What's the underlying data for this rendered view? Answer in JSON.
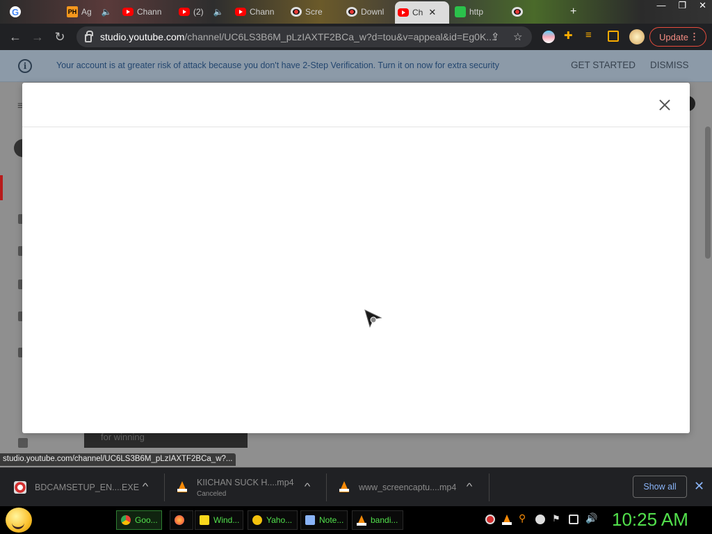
{
  "browser": {
    "tabs": [
      {
        "title": "G",
        "icon": "google-icon"
      },
      {
        "title": "Ag",
        "icon": "ph-icon",
        "muted": true
      },
      {
        "title": "Chann",
        "icon": "youtube-icon"
      },
      {
        "title": "(2)",
        "icon": "youtube-icon",
        "muted": true
      },
      {
        "title": "Chann",
        "icon": "youtube-icon"
      },
      {
        "title": "Scre",
        "icon": "recording-icon"
      },
      {
        "title": "Downl",
        "icon": "recording-icon"
      },
      {
        "title": "Ch",
        "icon": "youtube-icon",
        "active": true
      },
      {
        "title": "http",
        "icon": "green-icon"
      },
      {
        "title": "",
        "icon": "recording-icon"
      }
    ],
    "url_host": "studio.youtube.com",
    "url_rest": "/channel/UC6LS3B6M_pLzIAXTF2BCa_w?d=tou&v=appeal&id=Eg0K...",
    "update_label": "Update",
    "status_url": "studio.youtube.com/channel/UC6LS3B6M_pLzIAXTF2BCa_w?..."
  },
  "banner": {
    "text": "Your account is at greater risk of attack because you don't have 2-Step Verification. Turn it on now for extra security",
    "get_started": "GET STARTED",
    "dismiss": "DISMISS"
  },
  "background": {
    "card_text": "for winning"
  },
  "downloads": {
    "items": [
      {
        "name": "BDCAMSETUP_EN....EXE",
        "status": ""
      },
      {
        "name": "KIICHAN SUCK H....mp4",
        "status": "Canceled"
      },
      {
        "name": "www_screencaptu....mp4",
        "status": ""
      }
    ],
    "show_all": "Show all"
  },
  "taskbar": {
    "tasks": [
      {
        "label": "Goo...",
        "color": "#4285f4",
        "active": true
      },
      {
        "label": "",
        "color": "#ff7139"
      },
      {
        "label": "Wind...",
        "color": "#f9d71c"
      },
      {
        "label": "Yaho...",
        "color": "#f4c20d"
      },
      {
        "label": "Note...",
        "color": "#8ab4f8"
      },
      {
        "label": "bandi...",
        "color": "#f58a07"
      }
    ],
    "clock": "10:25 AM"
  },
  "colors": {
    "accent_green": "#52e04c",
    "update_red": "#e84c3d",
    "link_blue": "#8ab4f8"
  }
}
